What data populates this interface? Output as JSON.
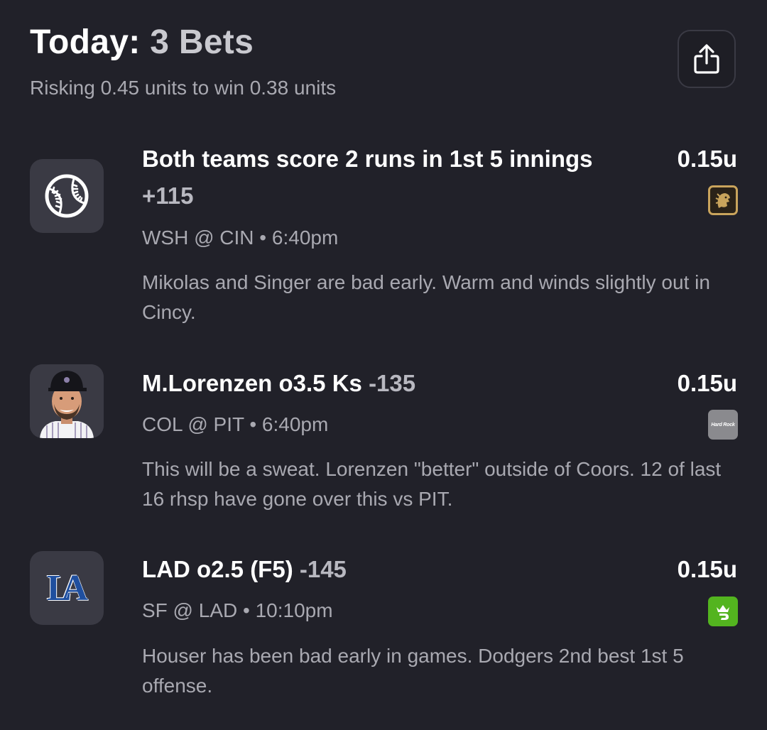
{
  "header": {
    "title_prefix": "Today:",
    "title_count": "3 Bets",
    "subtitle": "Risking 0.45 units to win 0.38 units",
    "share_icon": "share-icon"
  },
  "colors": {
    "background": "#212129",
    "card_tile": "#3a3a44",
    "text_primary": "#ffffff",
    "text_secondary": "#a9a9b1",
    "book_betmgm": "#c9a45c",
    "book_hardrock": "#8a8a8e",
    "book_draftkings": "#53b41f",
    "dodgers_blue": "#1f4f9f"
  },
  "bets": [
    {
      "icon": "baseball-icon",
      "title": "Both teams score 2 runs in 1st 5 innings",
      "odds": "+115",
      "units": "0.15u",
      "book_icon": "betmgm-logo",
      "matchup": "WSH @ CIN • 6:40pm",
      "note": "Mikolas and Singer are bad early. Warm and winds slightly out in Cincy."
    },
    {
      "icon": "player-photo",
      "title": "M.Lorenzen o3.5 Ks",
      "odds": "-135",
      "units": "0.15u",
      "book_icon": "hard-rock-bet-logo",
      "book_text": "Hard Rock",
      "matchup": "COL @ PIT • 6:40pm",
      "note": "This will be a sweat. Lorenzen \"better\" outside of Coors. 12 of last 16 rhsp have gone over this vs PIT."
    },
    {
      "icon": "dodgers-logo",
      "logo_text": "LA",
      "title": "LAD o2.5 (F5)",
      "odds": "-145",
      "units": "0.15u",
      "book_icon": "draftkings-logo",
      "matchup": "SF @ LAD • 10:10pm",
      "note": "Houser has been bad early in games. Dodgers 2nd best 1st 5 offense."
    }
  ]
}
